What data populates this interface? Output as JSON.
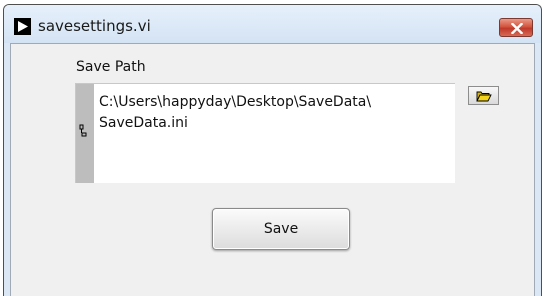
{
  "window": {
    "title": "savesettings.vi"
  },
  "save_path": {
    "label": "Save Path",
    "value": "C:\\Users\\happyday\\Desktop\\SaveData\\\nSaveData.ini"
  },
  "buttons": {
    "save_label": "Save",
    "browse_icon": "folder-open-icon",
    "close_icon": "close-icon"
  },
  "colors": {
    "title_bar": "#d4e3f4",
    "close_button": "#c0392b",
    "panel_background": "#f0f0f0",
    "folder_icon": "#f2d21a"
  }
}
